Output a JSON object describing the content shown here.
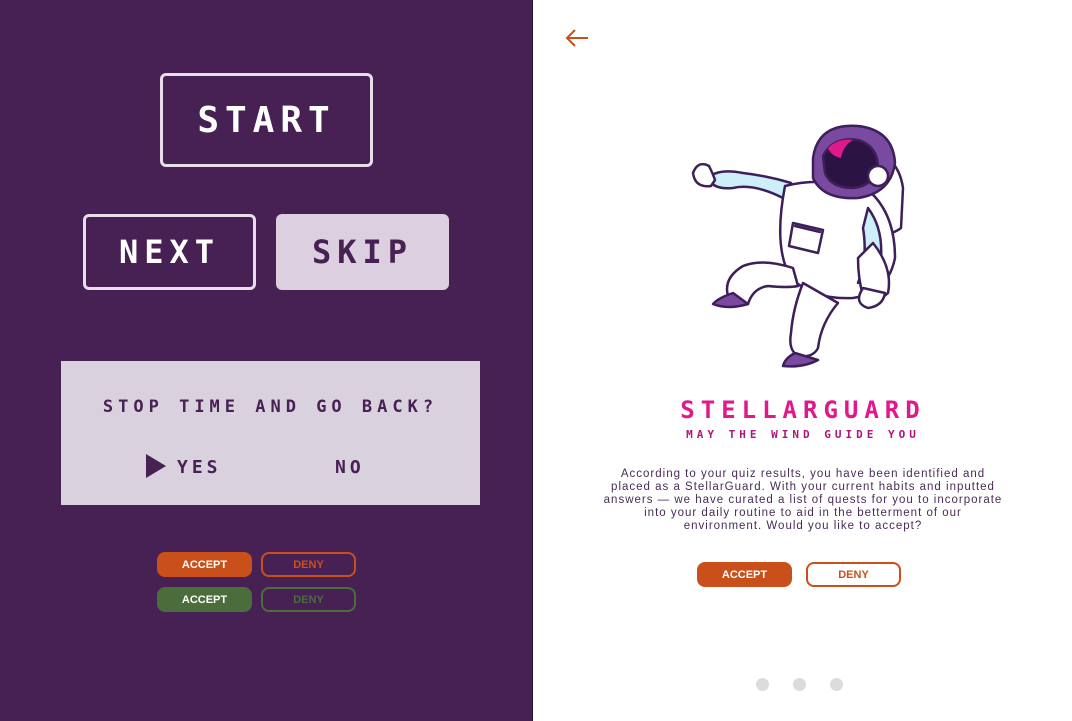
{
  "left_panel": {
    "start_label": "START",
    "next_label": "NEXT",
    "skip_label": "SKIP",
    "dialog": {
      "question": "STOP TIME AND GO BACK?",
      "yes_label": "YES",
      "no_label": "NO"
    },
    "accept_label": "ACCEPT",
    "deny_label": "DENY",
    "accept_green_label": "ACCEPT",
    "deny_green_label": "DENY"
  },
  "right_panel": {
    "brand_title": "STELLARGUARD",
    "tagline": "MAY THE WIND GUIDE YOU",
    "description": "According to your quiz results, you have been identified and placed as a StellarGuard. With your current habits and inputted answers — we have curated a list of quests for you to incorporate into your daily routine to aid in the betterment of our environment. Would you like to accept?",
    "accept_label": "ACCEPT",
    "deny_label": "DENY",
    "pagination": {
      "current": 1,
      "total": 3
    }
  },
  "icons": [
    "back-arrow-icon",
    "play-arrow-icon",
    "astronaut-illustration"
  ],
  "colors": {
    "panel_bg": "#472153",
    "accent_orange": "#c9501a",
    "accent_green": "#4b6d3b",
    "brand_pink": "#e0188a"
  }
}
